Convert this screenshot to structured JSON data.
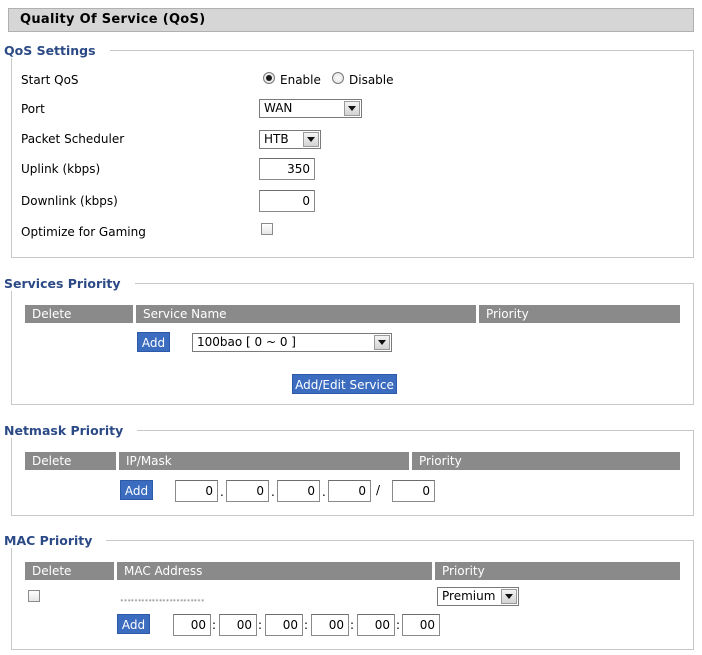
{
  "page": {
    "title": "Quality Of Service (QoS)"
  },
  "qos_settings": {
    "legend": "QoS Settings",
    "start_qos_label": "Start QoS",
    "enable_label": "Enable",
    "disable_label": "Disable",
    "start_qos_value": "Enable",
    "port_label": "Port",
    "port_value": "WAN",
    "packet_scheduler_label": "Packet Scheduler",
    "packet_scheduler_value": "HTB",
    "uplink_label": "Uplink (kbps)",
    "uplink_value": "350",
    "downlink_label": "Downlink (kbps)",
    "downlink_value": "0",
    "gaming_label": "Optimize for Gaming",
    "gaming_checked": false
  },
  "services_priority": {
    "legend": "Services Priority",
    "columns": [
      "Delete",
      "Service Name",
      "Priority"
    ],
    "add_label": "Add",
    "service_select_value": "100bao [ 0 ~ 0 ]",
    "add_edit_label": "Add/Edit Service"
  },
  "netmask_priority": {
    "legend": "Netmask Priority",
    "columns": [
      "Delete",
      "IP/Mask",
      "Priority"
    ],
    "add_label": "Add",
    "ip_octets": [
      "0",
      "0",
      "0",
      "0"
    ],
    "mask_value": "0",
    "dot": ".",
    "slash": "/"
  },
  "mac_priority": {
    "legend": "MAC Priority",
    "columns": [
      "Delete",
      "MAC Address",
      "Priority"
    ],
    "rows": [
      {
        "mac": "……………………",
        "priority": "Premium",
        "delete_checked": false
      }
    ],
    "add_label": "Add",
    "mac_octets": [
      "00",
      "00",
      "00",
      "00",
      "00",
      "00"
    ],
    "colon": ":"
  }
}
